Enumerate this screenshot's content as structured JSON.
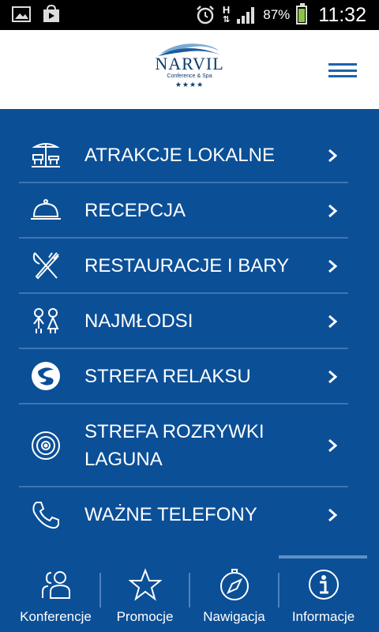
{
  "status_bar": {
    "h_indicator": "H",
    "battery_percent": "87%",
    "time": "11:32"
  },
  "header": {
    "logo": {
      "name": "NARVIL",
      "subtitle": "Conference & Spa",
      "stars": "★★★★"
    }
  },
  "menu": {
    "items": [
      {
        "label": "ATRAKCJE LOKALNE",
        "icon": "beach-umbrella-icon"
      },
      {
        "label": "RECEPCJA",
        "icon": "cloche-icon"
      },
      {
        "label": "RESTAURACJE I BARY",
        "icon": "fork-knife-icon"
      },
      {
        "label": "NAJMŁODSI",
        "icon": "children-icon"
      },
      {
        "label": "STREFA RELAKSU",
        "icon": "spa-stones-icon"
      },
      {
        "label_line1": "STREFA ROZRYWKI",
        "label_line2": "LAGUNA",
        "icon": "target-icon"
      },
      {
        "label": "WAŻNE TELEFONY",
        "icon": "phone-icon"
      }
    ]
  },
  "bottom_nav": {
    "items": [
      {
        "label": "Konferencje",
        "icon": "users-icon"
      },
      {
        "label": "Promocje",
        "icon": "star-icon"
      },
      {
        "label": "Nawigacja",
        "icon": "compass-icon"
      },
      {
        "label": "Informacje",
        "icon": "info-icon",
        "active": true
      }
    ]
  },
  "colors": {
    "background": "#0b4f97",
    "separator": "#3d76b3",
    "header_bg": "#ffffff",
    "accent": "#1a63ae"
  }
}
